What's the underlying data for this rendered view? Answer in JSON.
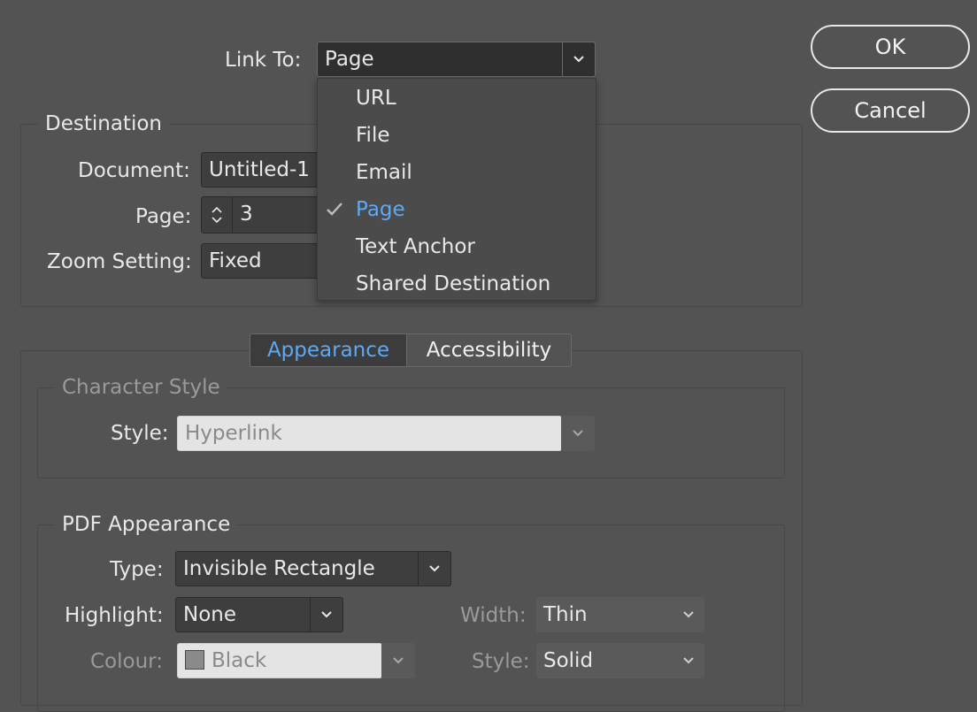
{
  "link_to": {
    "label": "Link To:",
    "value": "Page",
    "menu_items": [
      {
        "label": "URL",
        "selected": false
      },
      {
        "label": "File",
        "selected": false
      },
      {
        "label": "Email",
        "selected": false
      },
      {
        "label": "Page",
        "selected": true
      },
      {
        "label": "Text Anchor",
        "selected": false
      },
      {
        "label": "Shared Destination",
        "selected": false
      }
    ]
  },
  "buttons": {
    "ok": "OK",
    "cancel": "Cancel"
  },
  "destination": {
    "title": "Destination",
    "document_label": "Document:",
    "document_value": "Untitled-1",
    "page_label": "Page:",
    "page_value": "3",
    "zoom_label": "Zoom Setting:",
    "zoom_value": "Fixed"
  },
  "tabs": [
    {
      "label": "Appearance",
      "active": true
    },
    {
      "label": "Accessibility",
      "active": false
    }
  ],
  "character_style": {
    "title": "Character Style",
    "style_label": "Style:",
    "style_value": "Hyperlink"
  },
  "pdf_appearance": {
    "title": "PDF Appearance",
    "type_label": "Type:",
    "type_value": "Invisible Rectangle",
    "highlight_label": "Highlight:",
    "highlight_value": "None",
    "colour_label": "Colour:",
    "colour_value": "Black",
    "width_label": "Width:",
    "width_value": "Thin",
    "style_label": "Style:",
    "style_value": "Solid"
  },
  "colors": {
    "accent": "#5fa8f2",
    "background": "#535353"
  }
}
